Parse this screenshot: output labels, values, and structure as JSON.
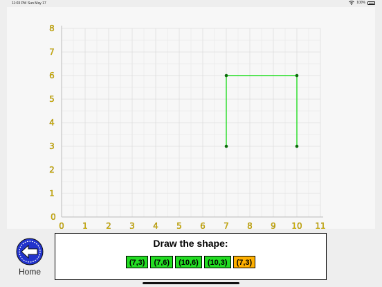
{
  "status_bar": {
    "time": "11:03 PM",
    "date": "Sun May 17",
    "battery": "100%",
    "wifi_icon": "wifi-icon",
    "battery_icon": "battery-icon"
  },
  "grid": {
    "x_ticks": [
      "0",
      "1",
      "2",
      "3",
      "4",
      "5",
      "6",
      "7",
      "8",
      "9",
      "10",
      "11"
    ],
    "y_ticks": [
      "0",
      "1",
      "2",
      "3",
      "4",
      "5",
      "6",
      "7",
      "8"
    ],
    "xlim": [
      0,
      11
    ],
    "ylim": [
      0,
      8
    ],
    "axis_label_color": "#e0c000",
    "shape_color": "#22dd22",
    "point_color": "#0b6b0b",
    "drawn_points": [
      [
        7,
        3
      ],
      [
        7,
        6
      ],
      [
        10,
        6
      ],
      [
        10,
        3
      ]
    ]
  },
  "home": {
    "label": "Home",
    "icon": "back-arrow-icon"
  },
  "prompt": {
    "title": "Draw the shape:",
    "points": [
      {
        "label": "(7,3)",
        "state": "done"
      },
      {
        "label": "(7,6)",
        "state": "done"
      },
      {
        "label": "(10,6)",
        "state": "done"
      },
      {
        "label": "(10,3)",
        "state": "done"
      },
      {
        "label": "(7,3)",
        "state": "current"
      }
    ],
    "done_color": "#22dd22",
    "current_color": "#ffb000"
  }
}
